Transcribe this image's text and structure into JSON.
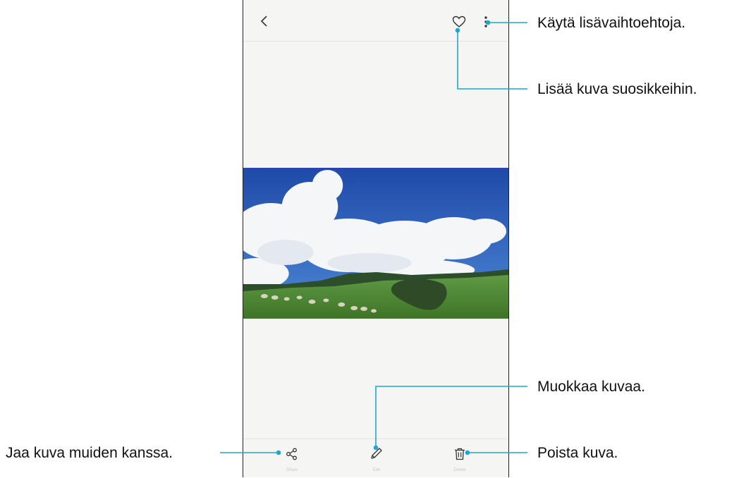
{
  "topbar": {
    "back_icon": "chevron-left-icon",
    "favorite_icon": "heart-outline-icon",
    "more_icon": "more-vertical-icon"
  },
  "bottombar": {
    "share_label": "Share",
    "edit_label": "Edit",
    "delete_label": "Delete",
    "share_icon": "share-icon",
    "edit_icon": "pencil-icon",
    "delete_icon": "trash-icon"
  },
  "callouts": {
    "more_options": "Käytä lisävaihtoehtoja.",
    "add_favorites": "Lisää kuva suosikkeihin.",
    "edit_image": "Muokkaa kuvaa.",
    "share_image": "Jaa kuva muiden kanssa.",
    "delete_image": "Poista kuva."
  },
  "colors": {
    "accent": "#20a7cf",
    "screen_bg": "#f5f6f4",
    "sky": "#2a58b8",
    "grass": "#4f8a36"
  }
}
